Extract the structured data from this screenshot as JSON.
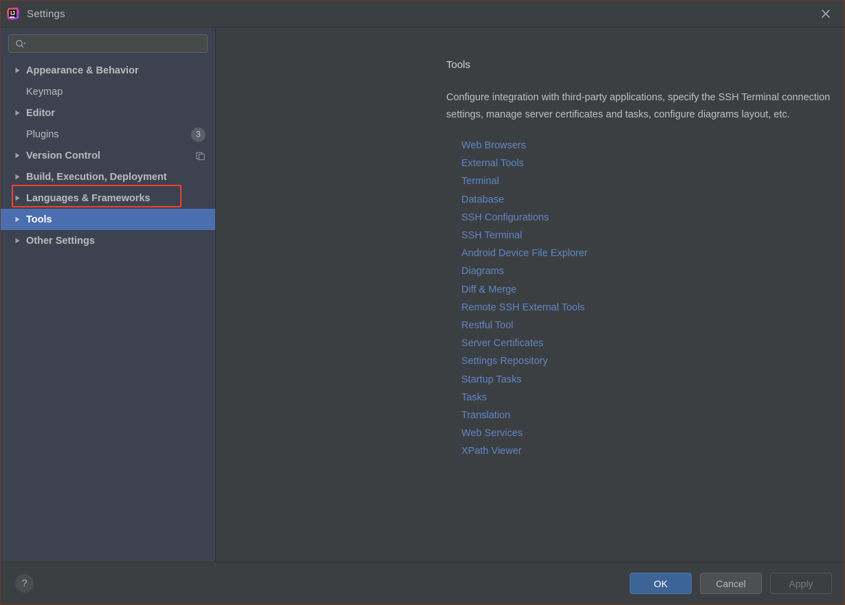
{
  "window": {
    "title": "Settings",
    "logo_icon": "intellij-idea-logo",
    "close_icon": "close-icon"
  },
  "sidebar": {
    "search": {
      "icon": "search-icon",
      "value": "",
      "placeholder": ""
    },
    "items": [
      {
        "label": "Appearance & Behavior",
        "expandable": true,
        "selected": false,
        "badge": null,
        "right_icon": null
      },
      {
        "label": "Keymap",
        "expandable": false,
        "selected": false,
        "badge": null,
        "right_icon": null
      },
      {
        "label": "Editor",
        "expandable": true,
        "selected": false,
        "badge": null,
        "right_icon": null
      },
      {
        "label": "Plugins",
        "expandable": false,
        "selected": false,
        "badge": "3",
        "right_icon": null,
        "highlighted": true
      },
      {
        "label": "Version Control",
        "expandable": true,
        "selected": false,
        "badge": null,
        "right_icon": "copy-icon"
      },
      {
        "label": "Build, Execution, Deployment",
        "expandable": true,
        "selected": false,
        "badge": null,
        "right_icon": null
      },
      {
        "label": "Languages & Frameworks",
        "expandable": true,
        "selected": false,
        "badge": null,
        "right_icon": null
      },
      {
        "label": "Tools",
        "expandable": true,
        "selected": true,
        "badge": null,
        "right_icon": null
      },
      {
        "label": "Other Settings",
        "expandable": true,
        "selected": false,
        "badge": null,
        "right_icon": null
      }
    ]
  },
  "main": {
    "title": "Tools",
    "description": "Configure integration with third-party applications, specify the SSH Terminal connection settings, manage server certificates and tasks, configure diagrams layout, etc.",
    "links": [
      "Web Browsers",
      "External Tools",
      "Terminal",
      "Database",
      "SSH Configurations",
      "SSH Terminal",
      "Android Device File Explorer",
      "Diagrams",
      "Diff & Merge",
      "Remote SSH External Tools",
      "Restful Tool",
      "Server Certificates",
      "Settings Repository",
      "Startup Tasks",
      "Tasks",
      "Translation",
      "Web Services",
      "XPath Viewer"
    ]
  },
  "footer": {
    "help_label": "?",
    "ok_label": "OK",
    "cancel_label": "Cancel",
    "apply_label": "Apply"
  },
  "colors": {
    "window_bg": "#3c3f41",
    "sidebar_bg": "#3c4250",
    "selection_blue": "#4b6eaf",
    "link_blue": "#5c86c8",
    "primary_button": "#3c6497",
    "annotation_red": "#f4402e",
    "text": "#bbbbbb"
  }
}
